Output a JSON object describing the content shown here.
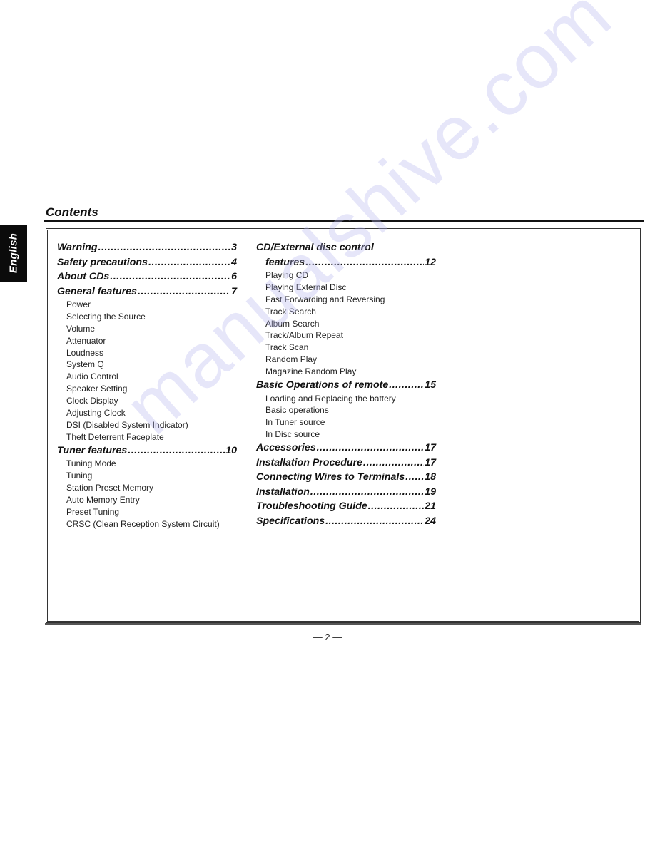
{
  "language_tab": "English",
  "page_title": "Contents",
  "page_number": "— 2 —",
  "watermark": "manualshive.com",
  "toc_left": [
    {
      "type": "head",
      "label": "Warning",
      "page": "3"
    },
    {
      "type": "head",
      "label": "Safety precautions",
      "page": "4"
    },
    {
      "type": "head",
      "label": "About CDs",
      "page": "6"
    },
    {
      "type": "head",
      "label": "General features",
      "page": "7"
    },
    {
      "type": "sub",
      "label": "Power"
    },
    {
      "type": "sub",
      "label": "Selecting the Source"
    },
    {
      "type": "sub",
      "label": "Volume"
    },
    {
      "type": "sub",
      "label": "Attenuator"
    },
    {
      "type": "sub",
      "label": "Loudness"
    },
    {
      "type": "sub",
      "label": "System Q"
    },
    {
      "type": "sub",
      "label": "Audio Control"
    },
    {
      "type": "sub",
      "label": "Speaker Setting"
    },
    {
      "type": "sub",
      "label": "Clock Display"
    },
    {
      "type": "sub",
      "label": "Adjusting Clock"
    },
    {
      "type": "sub",
      "label": "DSI (Disabled System Indicator)"
    },
    {
      "type": "sub",
      "label": "Theft Deterrent Faceplate"
    },
    {
      "type": "head",
      "label": "Tuner features",
      "page": "10"
    },
    {
      "type": "sub",
      "label": "Tuning Mode"
    },
    {
      "type": "sub",
      "label": "Tuning"
    },
    {
      "type": "sub",
      "label": "Station Preset Memory"
    },
    {
      "type": "sub",
      "label": "Auto Memory Entry"
    },
    {
      "type": "sub",
      "label": "Preset Tuning"
    },
    {
      "type": "sub",
      "label": "CRSC (Clean Reception System Circuit)"
    }
  ],
  "toc_right": [
    {
      "type": "headline",
      "label": "CD/External disc control"
    },
    {
      "type": "head-indent",
      "label": "features",
      "page": "12"
    },
    {
      "type": "sub",
      "label": "Playing CD"
    },
    {
      "type": "sub",
      "label": "Playing External Disc"
    },
    {
      "type": "sub",
      "label": "Fast Forwarding and Reversing"
    },
    {
      "type": "sub",
      "label": "Track Search"
    },
    {
      "type": "sub",
      "label": "Album Search"
    },
    {
      "type": "sub",
      "label": "Track/Album Repeat"
    },
    {
      "type": "sub",
      "label": "Track Scan"
    },
    {
      "type": "sub",
      "label": "Random Play"
    },
    {
      "type": "sub",
      "label": "Magazine Random Play"
    },
    {
      "type": "head",
      "label": "Basic Operations of remote",
      "page": "15"
    },
    {
      "type": "sub",
      "label": "Loading and Replacing the battery"
    },
    {
      "type": "sub",
      "label": "Basic operations"
    },
    {
      "type": "sub",
      "label": "In Tuner source"
    },
    {
      "type": "sub",
      "label": "In Disc source"
    },
    {
      "type": "head",
      "label": "Accessories",
      "page": "17"
    },
    {
      "type": "head",
      "label": "Installation Procedure",
      "page": "17"
    },
    {
      "type": "head",
      "label": "Connecting Wires to Terminals",
      "page": "18"
    },
    {
      "type": "head",
      "label": "Installation",
      "page": "19"
    },
    {
      "type": "head",
      "label": "Troubleshooting Guide",
      "page": "21"
    },
    {
      "type": "head",
      "label": "Specifications",
      "page": "24"
    }
  ]
}
